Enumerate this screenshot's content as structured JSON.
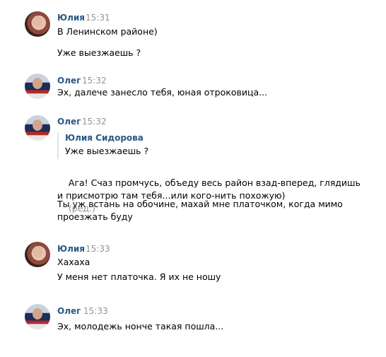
{
  "messages": [
    {
      "author": "Юлия",
      "time": "15:31",
      "lines": [
        "В Ленинском районе)",
        "Уже выезжаешь ?"
      ]
    },
    {
      "author": "Олег",
      "time": "15:32",
      "lines": [
        "Эх, далече занесло тебя, юная отроковица..."
      ]
    },
    {
      "author": "Олег",
      "time": "15:32",
      "quote": {
        "author": "Юлия Сидорова",
        "text": "Уже выезжаешь ?"
      },
      "lines": [
        "Ага! Счаз промчусь, объеду весь район взад-вперед, глядишь\nи присмотрю там тебя...или кого-нить похожую)",
        "Ты уж встань на обочине, махай мне платочком, когда мимо\nпроезжать буду"
      ],
      "edited": "(ред.)"
    },
    {
      "author": "Юлия",
      "time": "15:33",
      "lines": [
        "Хахаха",
        "У меня нет платочка. Я их не ношу"
      ]
    },
    {
      "author": "Олег",
      "time": "15:33",
      "lines": [
        "Эх, молодежь нонче такая пошла..."
      ]
    }
  ]
}
